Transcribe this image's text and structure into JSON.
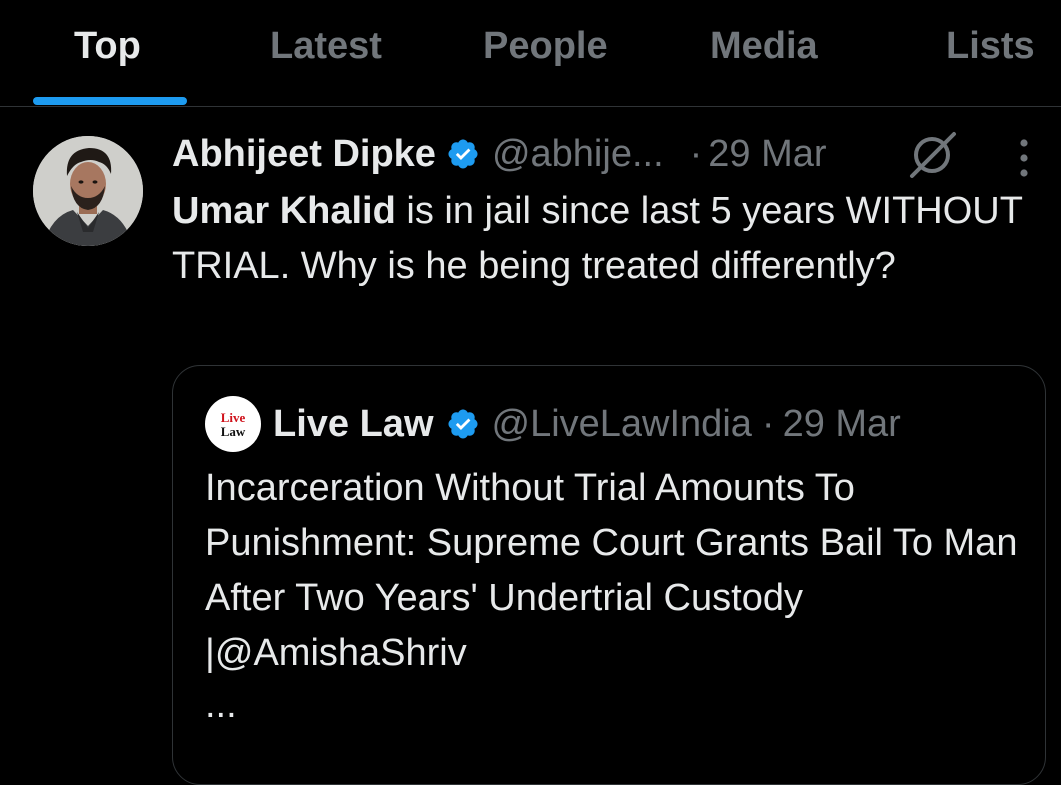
{
  "tabs": [
    {
      "label": "Top",
      "active": true
    },
    {
      "label": "Latest",
      "active": false
    },
    {
      "label": "People",
      "active": false
    },
    {
      "label": "Media",
      "active": false
    },
    {
      "label": "Lists",
      "active": false
    }
  ],
  "tweet": {
    "author": {
      "name": "Abhijeet Dipke",
      "handle": "@abhije...",
      "verified": true
    },
    "separator": "·",
    "date": "29 Mar",
    "text": {
      "mention": "Umar Khalid",
      "body": " is in jail since last 5 years WITHOUT TRIAL. Why is he being treated differently?"
    },
    "icons": [
      "avatar",
      "verified-badge-icon",
      "grok-icon",
      "more-options-icon"
    ]
  },
  "quote": {
    "author": {
      "name": "Live Law",
      "handle": "@LiveLawIndia",
      "verified": true,
      "logo_text_top": "Live",
      "logo_text_bottom": "Law"
    },
    "separator": "·",
    "date": "29 Mar",
    "text": "Incarceration Without Trial Amounts To Punishment: Supreme Court Grants Bail To Man After Two Years' Undertrial Custody |@AmishaShriv",
    "ellipsis": "..."
  },
  "colors": {
    "background": "#000000",
    "primary_text": "#e7e9ea",
    "secondary_text": "#71767b",
    "accent": "#1d9bf0",
    "divider": "#2f3336"
  }
}
